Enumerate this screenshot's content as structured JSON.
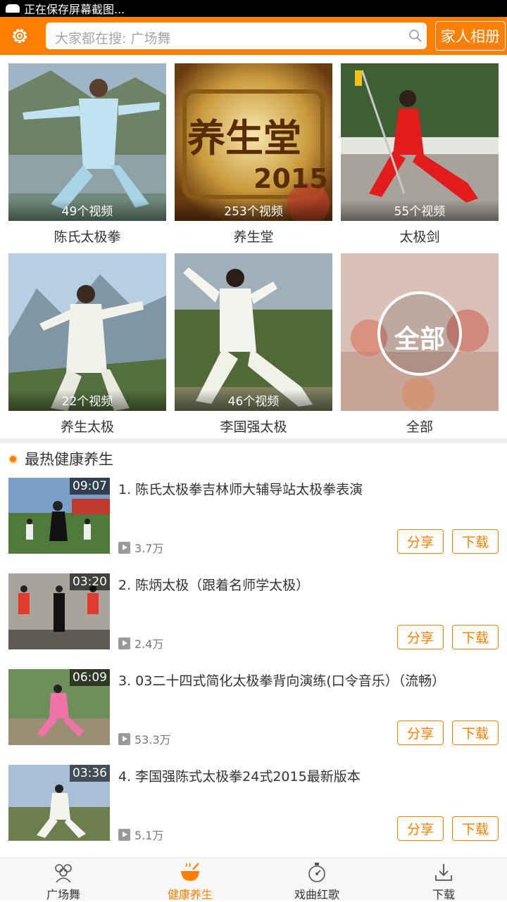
{
  "status_bar": {
    "text": "正在保存屏幕截图..."
  },
  "header": {
    "search_placeholder": "大家都在搜: 广场舞",
    "family_album_label": "家人相册"
  },
  "categories": [
    {
      "name": "陈氏太极拳",
      "count": "49个视频"
    },
    {
      "name": "养生堂",
      "count": "253个视频",
      "thumb_text": "养生堂",
      "thumb_year": "2015"
    },
    {
      "name": "太极剑",
      "count": "55个视频"
    },
    {
      "name": "养生太极",
      "count": "22个视频"
    },
    {
      "name": "李国强太极",
      "count": "46个视频"
    },
    {
      "name": "全部",
      "thumb_text": "全部"
    }
  ],
  "section": {
    "title": "最热健康养生"
  },
  "videos": [
    {
      "title": "1. 陈氏太极拳吉林师大辅导站太极拳表演",
      "duration": "09:07",
      "plays": "3.7万"
    },
    {
      "title": "2. 陈炳太极（跟着名师学太极）",
      "duration": "03:20",
      "plays": "2.4万"
    },
    {
      "title": "3. 03二十四式简化太极拳背向演练(口令音乐）（流畅）",
      "duration": "06:09",
      "plays": "53.3万"
    },
    {
      "title": "4. 李国强陈式太极拳24式2015最新版本",
      "duration": "03:36",
      "plays": "5.1万"
    }
  ],
  "buttons": {
    "share": "分享",
    "download": "下载"
  },
  "nav": [
    {
      "label": "广场舞",
      "icon": "group-icon",
      "active": false
    },
    {
      "label": "健康养生",
      "icon": "bowl-icon",
      "active": true
    },
    {
      "label": "戏曲红歌",
      "icon": "stopwatch-icon",
      "active": false
    },
    {
      "label": "下载",
      "icon": "download-icon",
      "active": false
    }
  ],
  "colors": {
    "accent": "#ff7f00",
    "status_bar": "#000000",
    "nav_bg": "#f7f7f7"
  }
}
